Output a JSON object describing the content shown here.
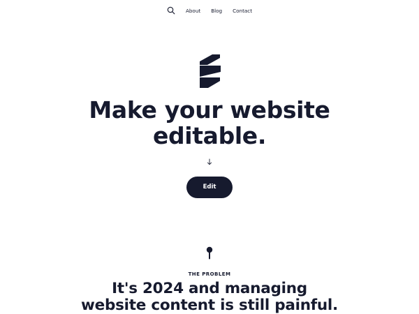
{
  "nav": {
    "search_icon": "search-icon",
    "links": [
      {
        "label": "About"
      },
      {
        "label": "Blog"
      },
      {
        "label": "Contact"
      }
    ]
  },
  "hero": {
    "logo_icon": "stacked-bars-logo",
    "title_lines": [
      "Make your website",
      "editable."
    ],
    "scroll_icon": "arrow-down-icon",
    "button_label": "Edit"
  },
  "problem": {
    "marker_icon": "pin-icon",
    "eyebrow": "THE PROBLEM",
    "title_lines": [
      "It's 2024 and managing",
      "website content is still painful."
    ]
  },
  "colors": {
    "text": "#161a2e",
    "button_background": "#161a2e",
    "button_text": "#ffffff",
    "page_background": "#ffffff"
  }
}
